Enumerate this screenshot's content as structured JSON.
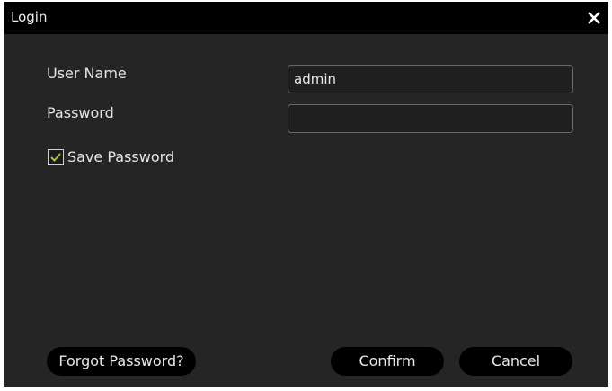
{
  "dialog": {
    "title": "Login",
    "close_icon": "close-icon"
  },
  "form": {
    "username_label": "User Name",
    "username_value": "admin",
    "password_label": "Password",
    "password_value": "",
    "save_password_label": "Save Password",
    "save_password_checked": true
  },
  "buttons": {
    "forgot_password": "Forgot Password?",
    "confirm": "Confirm",
    "cancel": "Cancel"
  },
  "colors": {
    "dialog_background": "#252525",
    "titlebar_background": "#000000",
    "checkmark": "#9acd32",
    "text": "#e6e6e6"
  }
}
